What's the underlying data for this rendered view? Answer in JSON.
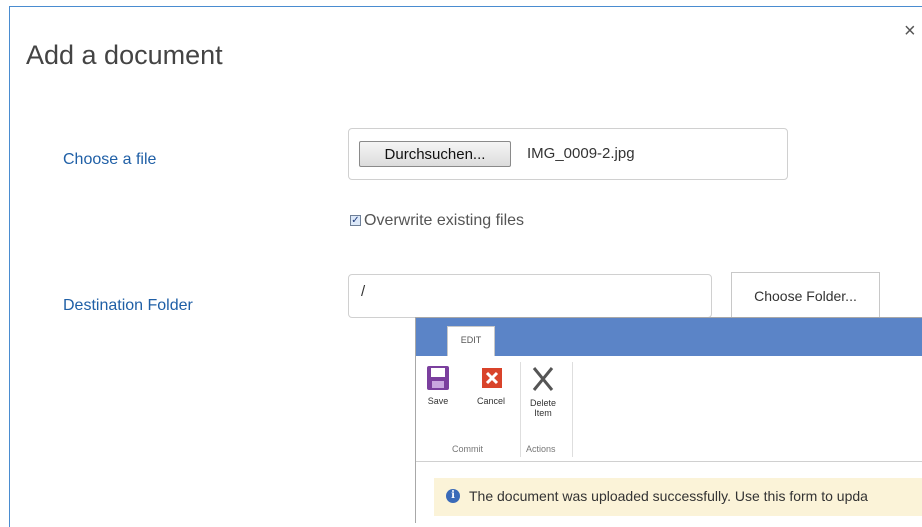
{
  "dialog": {
    "title": "Add a document",
    "close_symbol": "×"
  },
  "form": {
    "choose_file_label": "Choose a file",
    "browse_button_label": "Durchsuchen...",
    "selected_file": "IMG_0009-2.jpg",
    "overwrite_checked": true,
    "overwrite_label": "Overwrite existing files",
    "destination_label": "Destination Folder",
    "destination_value": "/",
    "choose_folder_label": "Choose Folder..."
  },
  "inset": {
    "tab_label": "EDIT",
    "buttons": {
      "save": "Save",
      "cancel": "Cancel",
      "delete": "Delete Item"
    },
    "groups": {
      "commit": "Commit",
      "actions": "Actions"
    },
    "banner_icon": "i",
    "banner_text": "The document was uploaded successfully. Use this form to upda",
    "colors": {
      "ribbon": "#5b84c7",
      "banner": "#fbf3d8",
      "save": "#7b3f9e",
      "cancel": "#d9432a"
    }
  },
  "colors": {
    "label": "#1f5fa6",
    "dialog_border": "#4a8cd0"
  },
  "icons": [
    "close-icon",
    "checkbox-checked-icon",
    "save-icon",
    "cancel-icon",
    "delete-icon",
    "info-icon"
  ]
}
